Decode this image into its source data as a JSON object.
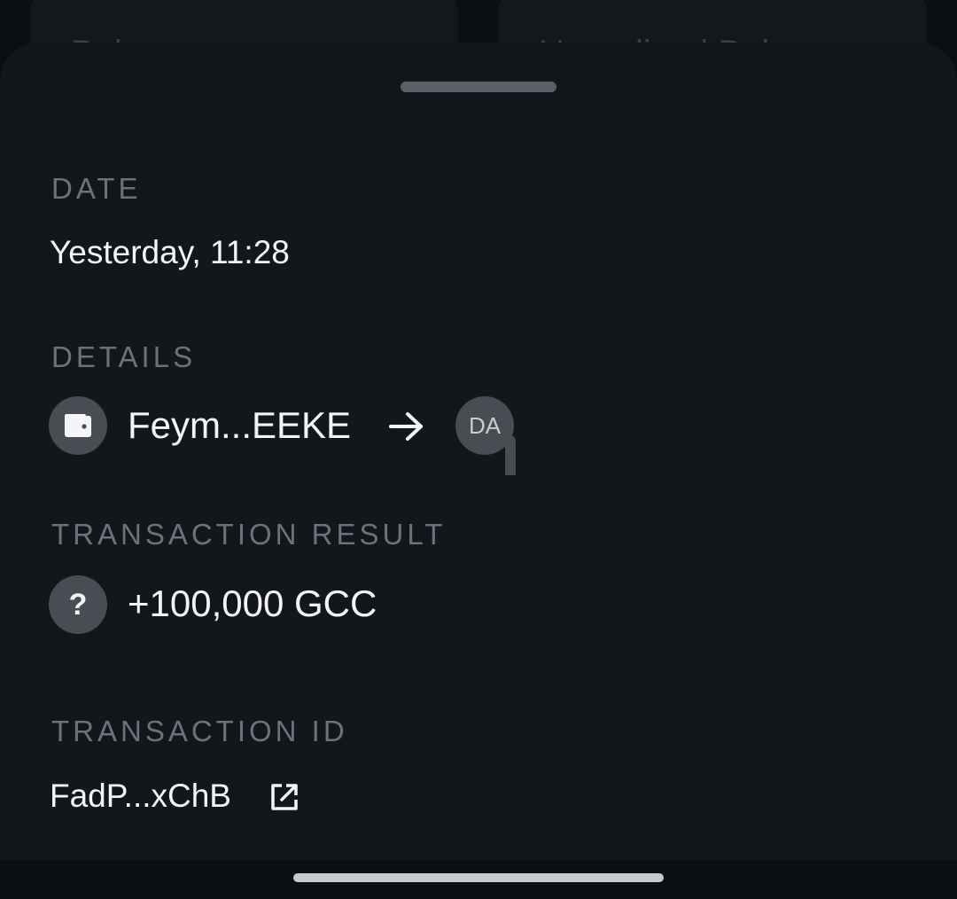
{
  "background": {
    "left_card_label": "Balance",
    "right_card_label": "Unrealized Balance"
  },
  "sheet": {
    "date": {
      "label": "DATE",
      "value": "Yesterday, 11:28"
    },
    "details": {
      "label": "DETAILS",
      "from": "Feym...EEKE",
      "to_avatar": "DA",
      "icons": [
        "wallet-icon",
        "arrow-right-icon"
      ]
    },
    "result": {
      "label": "TRANSACTION RESULT",
      "value": "+100,000 GCC",
      "token_icon": "?"
    },
    "transaction_id": {
      "label": "TRANSACTION ID",
      "value": "FadP...xChB",
      "icon": "external-link-icon"
    }
  },
  "colors": {
    "sheet_background": "#13161b",
    "label": "#6b727c",
    "text": "#f4f5f7",
    "avatar": "#494c52"
  }
}
